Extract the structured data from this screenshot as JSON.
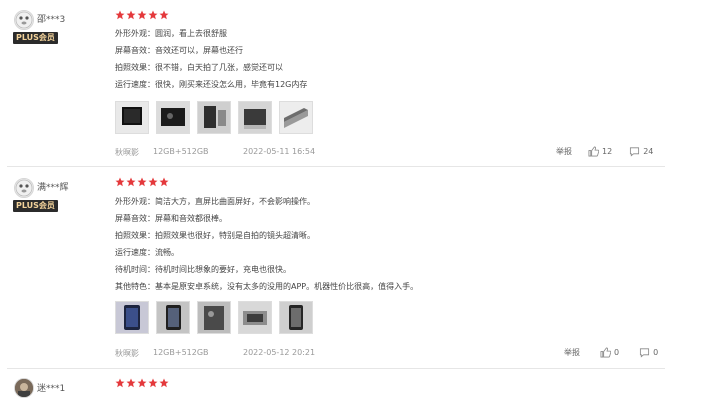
{
  "reviews": [
    {
      "username": "邵***3",
      "badge": "PLUS会员",
      "rating": 5,
      "lines": [
        {
          "key": "外形外观：",
          "value": "圆润，看上去很舒服"
        },
        {
          "key": "屏幕音效：",
          "value": "音效还可以，屏幕也还行"
        },
        {
          "key": "拍照效果：",
          "value": "很不错，白天拍了几张，感觉还可以"
        },
        {
          "key": "运行速度：",
          "value": "很快，刚买来还没怎么用，毕竟有12G内存"
        }
      ],
      "photo_count": 5,
      "variant": "秋暝影",
      "spec": "12GB+512GB",
      "date": "2022-05-11 16:54",
      "report_label": "举报",
      "likes": "12",
      "comments": "24"
    },
    {
      "username": "满***辉",
      "badge": "PLUS会员",
      "rating": 5,
      "lines": [
        {
          "key": "外形外观：",
          "value": "简洁大方，直屏比曲面屏好，不会影响操作。"
        },
        {
          "key": "屏幕音效：",
          "value": "屏幕和音效都很棒。"
        },
        {
          "key": "拍照效果：",
          "value": "拍照效果也很好，特别是自拍的镜头超清晰。"
        },
        {
          "key": "运行速度：",
          "value": "流畅。"
        },
        {
          "key": "待机时间：",
          "value": "待机时间比想象的要好，充电也很快。"
        },
        {
          "key": "其他特色：",
          "value": "基本是原安卓系统，没有太多的没用的APP。机器性价比很高，值得入手。"
        }
      ],
      "photo_count": 5,
      "variant": "秋暝影",
      "spec": "12GB+512GB",
      "date": "2022-05-12 20:21",
      "report_label": "举报",
      "likes": "0",
      "comments": "0"
    },
    {
      "username": "迷***1",
      "rating": 5
    }
  ],
  "colors": {
    "star": "#e4393c",
    "badge_bg": "#2b2b2b",
    "badge_text": "#f3d39b"
  },
  "icons": {
    "like": "thumb-up-icon",
    "comment": "comment-icon",
    "star": "star-icon"
  }
}
